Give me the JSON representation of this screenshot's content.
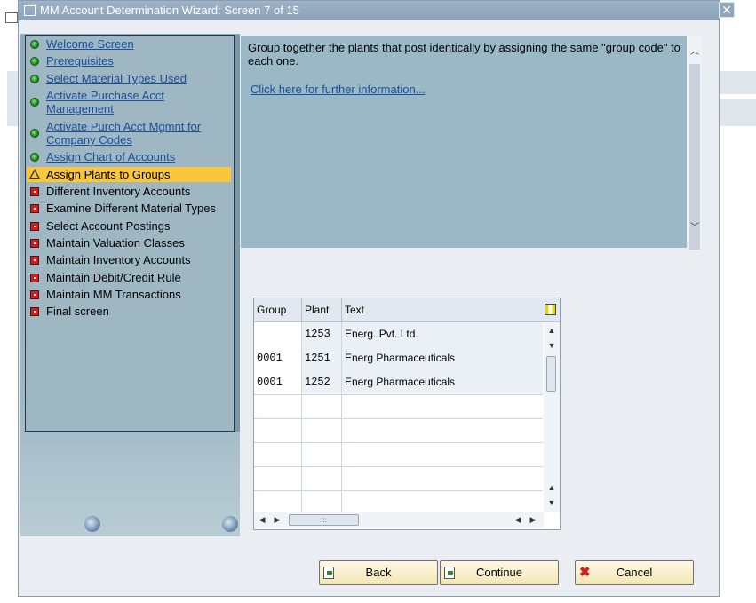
{
  "window": {
    "title": "MM Account Determination Wizard: Screen 7 of 15",
    "close_glyph": "✕"
  },
  "nav": {
    "items": [
      {
        "label": "Welcome Screen",
        "status": "done",
        "link": true
      },
      {
        "label": "Prerequisites",
        "status": "done",
        "link": true
      },
      {
        "label": "Select Material Types Used",
        "status": "done",
        "link": true
      },
      {
        "label": "Activate Purchase Acct Management",
        "status": "done",
        "link": true
      },
      {
        "label": "Activate Purch Acct Mgmnt for Company Codes",
        "status": "done",
        "link": true
      },
      {
        "label": "Assign Chart of Accounts",
        "status": "done",
        "link": true
      },
      {
        "label": "Assign Plants to Groups",
        "status": "current",
        "link": false
      },
      {
        "label": "Different Inventory Accounts",
        "status": "pending",
        "link": false
      },
      {
        "label": "Examine Different Material Types",
        "status": "pending",
        "link": false
      },
      {
        "label": "Select Account Postings",
        "status": "pending",
        "link": false
      },
      {
        "label": "Maintain Valuation Classes",
        "status": "pending",
        "link": false
      },
      {
        "label": "Maintain Inventory Accounts",
        "status": "pending",
        "link": false
      },
      {
        "label": "Maintain Debit/Credit Rule",
        "status": "pending",
        "link": false
      },
      {
        "label": "Maintain MM Transactions",
        "status": "pending",
        "link": false
      },
      {
        "label": "Final screen",
        "status": "pending",
        "link": false
      }
    ]
  },
  "info": {
    "text": "Group together the plants that post identically by assigning the same \"group code\" to each one.",
    "link": "Click here for further information..."
  },
  "table": {
    "columns": [
      "Group",
      "Plant",
      "Text"
    ],
    "rows": [
      {
        "group": "",
        "plant": "1253",
        "text": "Energ. Pvt. Ltd."
      },
      {
        "group": "0001",
        "plant": "1251",
        "text": "Energ Pharmaceuticals"
      },
      {
        "group": "0001",
        "plant": "1252",
        "text": "Energ Pharmaceuticals"
      }
    ]
  },
  "buttons": {
    "back": "Back",
    "continue": "Continue",
    "cancel": "Cancel"
  }
}
